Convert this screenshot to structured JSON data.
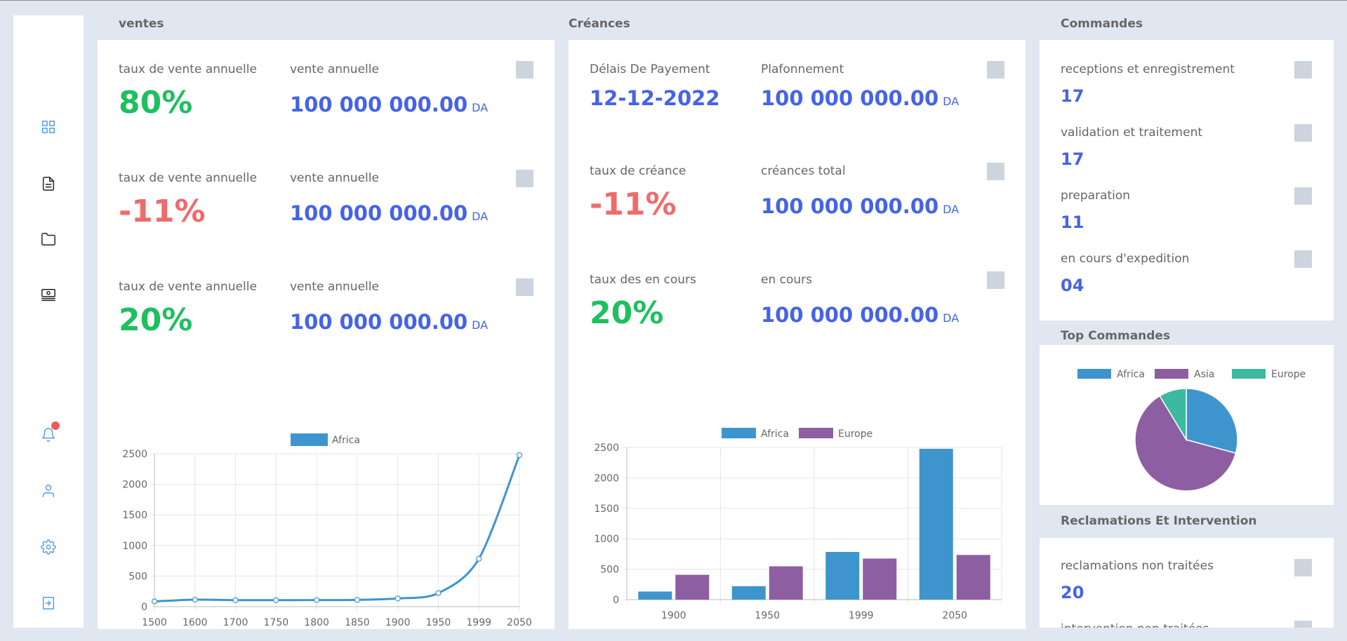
{
  "sidebar": {
    "icons": [
      "dashboard-grid-icon",
      "document-icon",
      "folder-icon",
      "money-stack-icon",
      "bell-icon",
      "user-icon",
      "settings-icon",
      "logout-icon"
    ]
  },
  "ventes": {
    "title": "ventes",
    "rows": [
      {
        "rate_label": "taux de vente annuelle",
        "rate": "80%",
        "sales_label": "vente annuelle",
        "amount": "100 000 000.00",
        "currency": "DA"
      },
      {
        "rate_label": "taux de vente annuelle",
        "rate": "-11%",
        "sales_label": "vente annuelle",
        "amount": "100 000 000.00",
        "currency": "DA"
      },
      {
        "rate_label": "taux de vente annuelle",
        "rate": "20%",
        "sales_label": "vente annuelle",
        "amount": "100 000 000.00",
        "currency": "DA"
      }
    ]
  },
  "creances": {
    "title": "Créances",
    "rows": [
      {
        "label": "Délais De Payement",
        "value": "12-12-2022",
        "amount_label": "Plafonnement",
        "amount": "100 000 000.00",
        "currency": "DA"
      },
      {
        "label": "taux de créance",
        "value": "-11%",
        "amount_label": "créances total",
        "amount": "100 000 000.00",
        "currency": "DA"
      },
      {
        "label": "taux des en cours",
        "value": "20%",
        "amount_label": "en cours",
        "amount": "100 000 000.00",
        "currency": "DA"
      }
    ]
  },
  "commandes": {
    "title": "Commandes",
    "items": [
      {
        "label": "receptions et enregistrement",
        "value": "17"
      },
      {
        "label": "validation et traitement",
        "value": "17"
      },
      {
        "label": "preparation",
        "value": "11"
      },
      {
        "label": "en cours d'expedition",
        "value": "04"
      }
    ]
  },
  "top_commandes": {
    "title": "Top Commandes"
  },
  "reclamations": {
    "title": "Reclamations Et Intervention",
    "items": [
      {
        "label": "reclamations non traitées",
        "value": "20"
      },
      {
        "label": "intervention non traitées",
        "value": ""
      }
    ]
  },
  "colors": {
    "africa": "#3e95cd",
    "asia": "#8e5ea2",
    "europe": "#3cba9f",
    "green": "#1fbf5f",
    "red": "#ef6b6b",
    "blue": "#4563e8"
  },
  "chart_data": [
    {
      "type": "line",
      "x": [
        "1500",
        "1600",
        "1700",
        "1750",
        "1800",
        "1850",
        "1900",
        "1950",
        "1999",
        "2050"
      ],
      "series": [
        {
          "name": "Africa",
          "values": [
            86,
            114,
            106,
            106,
            107,
            111,
            133,
            221,
            783,
            2478
          ],
          "color": "#3e95cd"
        }
      ],
      "ylim": [
        0,
        2500
      ],
      "yticks": [
        0,
        500,
        1000,
        1500,
        2000,
        2500
      ],
      "grid": true,
      "legend": "top"
    },
    {
      "type": "bar",
      "categories": [
        "1900",
        "1950",
        "1999",
        "2050"
      ],
      "series": [
        {
          "name": "Africa",
          "values": [
            133,
            221,
            783,
            2478
          ],
          "color": "#3e95cd"
        },
        {
          "name": "Europe",
          "values": [
            408,
            547,
            675,
            734
          ],
          "color": "#8e5ea2"
        }
      ],
      "ylim": [
        0,
        2500
      ],
      "yticks": [
        0,
        500,
        1000,
        1500,
        2000,
        2500
      ],
      "grid": true,
      "legend": "top"
    },
    {
      "type": "pie",
      "categories": [
        "Africa",
        "Asia",
        "Europe"
      ],
      "values": [
        2478,
        5267,
        734
      ],
      "colors": [
        "#3e95cd",
        "#8e5ea2",
        "#3cba9f"
      ],
      "legend": "top"
    }
  ]
}
